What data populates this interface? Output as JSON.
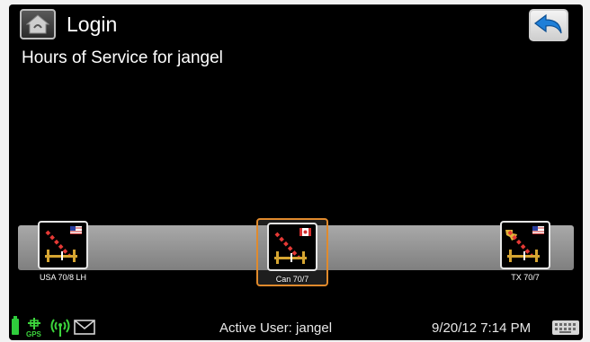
{
  "header": {
    "title": "Login",
    "subtitle": "Hours of Service for jangel"
  },
  "icons": {
    "home": "home-icon",
    "back": "back-arrow-icon"
  },
  "rulesets": [
    {
      "label": "USA 70/8 LH",
      "flag": "us",
      "selected": false
    },
    {
      "label": "Can 70/7",
      "flag": "ca",
      "selected": true
    },
    {
      "label": "TX 70/7",
      "flag": "tx-us",
      "selected": false
    }
  ],
  "status_bar": {
    "active_user": "Active User: jangel",
    "datetime": "9/20/12 7:14 PM",
    "gps_label": "GPS"
  },
  "colors": {
    "selection": "#e08a2c",
    "battery": "#2fcc3c",
    "background": "#000000",
    "back_arrow": "#1e7fd8"
  }
}
